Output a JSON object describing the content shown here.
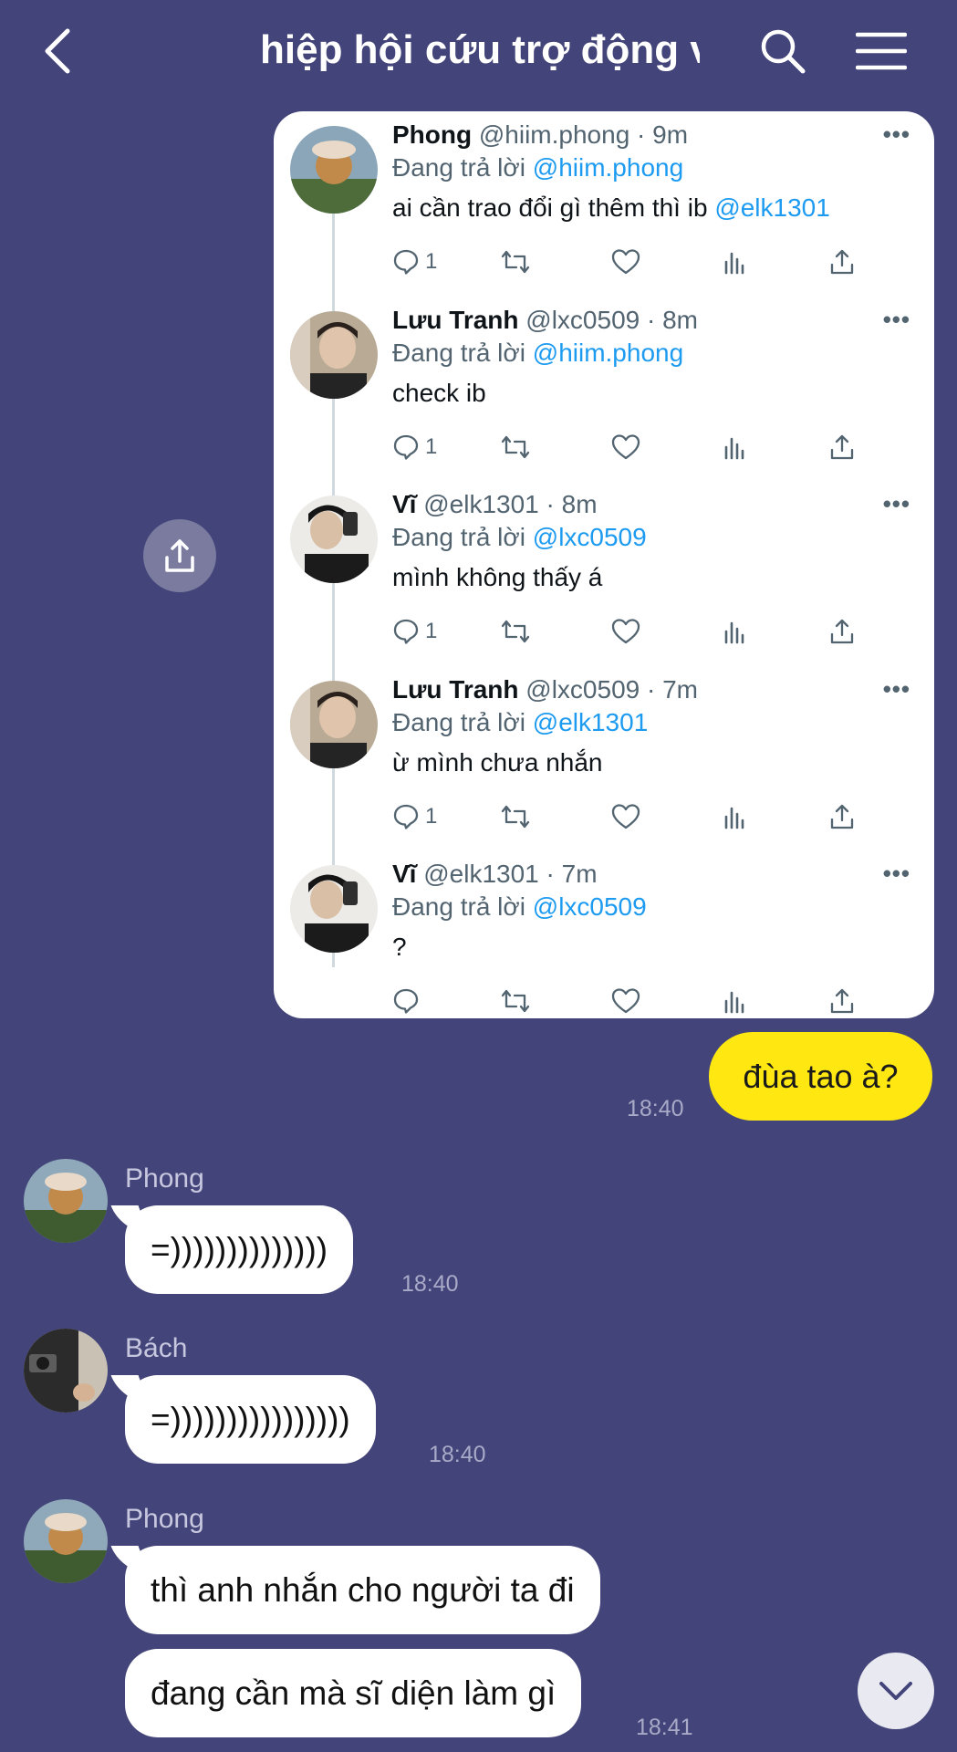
{
  "header": {
    "title": "hiệp hội cứu trợ động v"
  },
  "tweets": [
    {
      "name": "Phong",
      "meta": " @hiim.phong · 9m",
      "replying_prefix": "Đang trả lời ",
      "replying_to": "@hiim.phong",
      "text": "ai cần trao đổi gì thêm thì ib ",
      "text_mention": "@elk1301",
      "reply_count": "1"
    },
    {
      "name": "Lưu Tranh",
      "meta": " @lxc0509 · 8m",
      "replying_prefix": "Đang trả lời ",
      "replying_to": "@hiim.phong",
      "text": "check ib",
      "text_mention": "",
      "reply_count": "1"
    },
    {
      "name": "Vĩ",
      "meta": " @elk1301 · 8m",
      "replying_prefix": "Đang trả lời ",
      "replying_to": "@lxc0509",
      "text": "mình không thấy á",
      "text_mention": "",
      "reply_count": "1"
    },
    {
      "name": "Lưu Tranh",
      "meta": " @lxc0509 · 7m",
      "replying_prefix": "Đang trả lời ",
      "replying_to": "@elk1301",
      "text": "ừ mình chưa nhắn",
      "text_mention": "",
      "reply_count": "1"
    },
    {
      "name": "Vĩ",
      "meta": " @elk1301 · 7m",
      "replying_prefix": "Đang trả lời ",
      "replying_to": "@lxc0509",
      "text": "?",
      "text_mention": "",
      "reply_count": ""
    }
  ],
  "tweet_more": "•••",
  "messages": {
    "mine": {
      "text": "đùa tao à?",
      "time": "18:40"
    },
    "m1": {
      "sender": "Phong",
      "text": "=))))))))))))))",
      "time": "18:40"
    },
    "m2": {
      "sender": "Bách",
      "text": "=))))))))))))))))",
      "time": "18:40"
    },
    "m3": {
      "sender": "Phong",
      "text": "thì anh nhắn cho người ta đi"
    },
    "m4": {
      "text": "đang cần mà sĩ diện làm gì",
      "time": "18:41"
    }
  },
  "colors": {
    "background": "#434479",
    "my_bubble": "#ffe812",
    "link": "#1d9bf0"
  }
}
